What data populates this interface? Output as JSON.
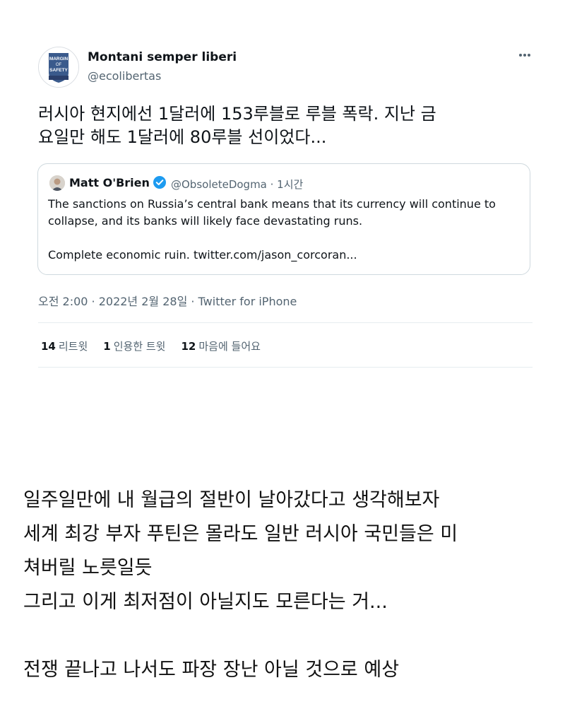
{
  "tweet": {
    "author_name": "Montani semper liberi",
    "author_handle": "@ecolibertas",
    "avatar_text": [
      "MARGIN",
      "OF",
      "SAFETY"
    ],
    "text": "러시아 현지에선 1달러에 153루블로 루블 폭락. 지난 금\n요일만 해도 1달러에 80루블 선이었다...",
    "quote": {
      "name": "Matt O'Brien",
      "handle_time": "@ObsoleteDogma · 1시간",
      "text": "The sanctions on Russia’s central bank means that its currency will continue to\ncollapse, and its banks will likely face devastating runs.\n\nComplete economic ruin. twitter.com/jason_corcoran..."
    },
    "timestamp": "오전 2:00 · 2022년 2월 28일 · Twitter for iPhone",
    "stats": {
      "retweets_count": "14",
      "retweets_label": "리트윗",
      "quotes_count": "1",
      "quotes_label": "인용한 트윗",
      "likes_count": "12",
      "likes_label": "마음에 들어요"
    },
    "icons": {
      "more": "more-horizontal-icon",
      "verified": "verified-badge-icon"
    },
    "colors": {
      "verified": "#1d9bf0",
      "secondary_text": "#536471",
      "border": "#cfd9de"
    }
  },
  "commentary": {
    "line1": "일주일만에 내 월급의 절반이 날아갔다고 생각해보자",
    "line2": "세계 최강 부자 푸틴은 몰라도 일반 러시아 국민들은 미",
    "line3": "쳐버릴 노릇일듯",
    "line4": "그리고 이게 최저점이 아닐지도 모른다는 거...",
    "line5": "전쟁 끝나고 나서도 파장 장난 아닐 것으로 예상"
  }
}
